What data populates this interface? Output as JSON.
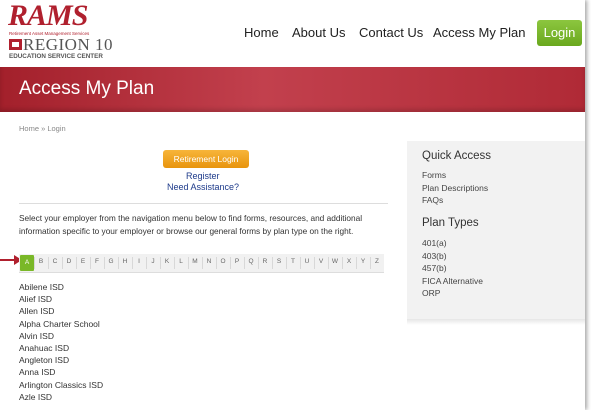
{
  "logo": {
    "brand": "RAMS",
    "tagline": "Retirement Asset Management Services",
    "region": "REGION 10",
    "sub": "EDUCATION SERVICE CENTER"
  },
  "nav": {
    "items": [
      "Home",
      "About Us",
      "Contact Us",
      "Access My Plan"
    ],
    "login_label": "Login"
  },
  "page": {
    "title": "Access My Plan",
    "breadcrumb": "Home » Login"
  },
  "login": {
    "retirement_login_label": "Retirement Login",
    "register_label": "Register",
    "need_assistance_label": "Need Assistance?"
  },
  "intro_text": "Select your employer from the navigation menu below to find forms, resources, and additional information specific to your employer or browse our general forms by plan type on the right.",
  "alphabet": {
    "letters": [
      "A",
      "B",
      "C",
      "D",
      "E",
      "F",
      "G",
      "H",
      "I",
      "J",
      "K",
      "L",
      "M",
      "N",
      "O",
      "P",
      "Q",
      "R",
      "S",
      "T",
      "U",
      "V",
      "W",
      "X",
      "Y",
      "Z"
    ],
    "selected": "A"
  },
  "districts": [
    "Abilene ISD",
    "Alief ISD",
    "Allen ISD",
    "Alpha Charter School",
    "Alvin ISD",
    "Anahuac ISD",
    "Angleton ISD",
    "Anna ISD",
    "Arlington Classics ISD",
    "Azle ISD"
  ],
  "sidebar": {
    "quick_access_title": "Quick Access",
    "quick_access_links": [
      "Forms",
      "Plan Descriptions",
      "FAQs"
    ],
    "plan_types_title": "Plan Types",
    "plan_types_links": [
      "401(a)",
      "403(b)",
      "457(b)",
      "FICA Alternative",
      "ORP"
    ]
  },
  "colors": {
    "brand_red": "#b0202e",
    "accent_green": "#7ab828",
    "login_orange": "#f0a020",
    "link_blue": "#1d3a8a"
  }
}
